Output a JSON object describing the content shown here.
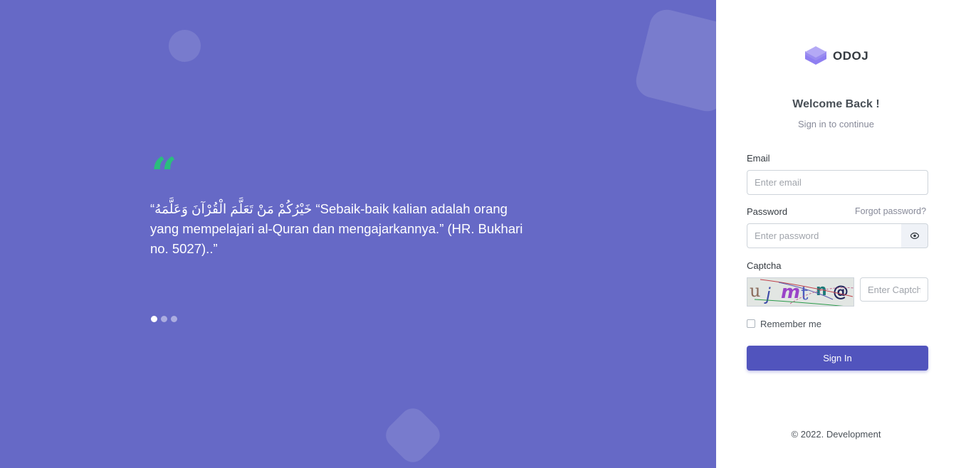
{
  "quote": {
    "mark": "“",
    "text": "“خَيْرُكُمْ مَنْ تَعَلَّمَ الْقُرْآنَ وَعَلَّمَهُ “Sebaik-baik kalian adalah orang yang mempelajari al-Quran dan mengajarkannya.” (HR. Bukhari no. 5027)..”",
    "slides_count": 3,
    "active_slide": 1
  },
  "brand": {
    "name": "ODOJ",
    "logo_icon": "layers-icon"
  },
  "header": {
    "title": "Welcome Back !",
    "subtitle": "Sign in to continue"
  },
  "form": {
    "email_label": "Email",
    "email_placeholder": "Enter email",
    "password_label": "Password",
    "password_placeholder": "Enter password",
    "forgot_label": "Forgot password?",
    "captcha_label": "Captcha",
    "captcha_text": "ujmtn@",
    "captcha_placeholder": "Enter Captcha",
    "remember_label": "Remember me",
    "signin_label": "Sign In"
  },
  "footer": {
    "text": "© 2022. Development"
  },
  "colors": {
    "left_panel_bg": "#6669c6",
    "quote_mark": "#2bbd7e",
    "primary_button": "#5154bd"
  }
}
